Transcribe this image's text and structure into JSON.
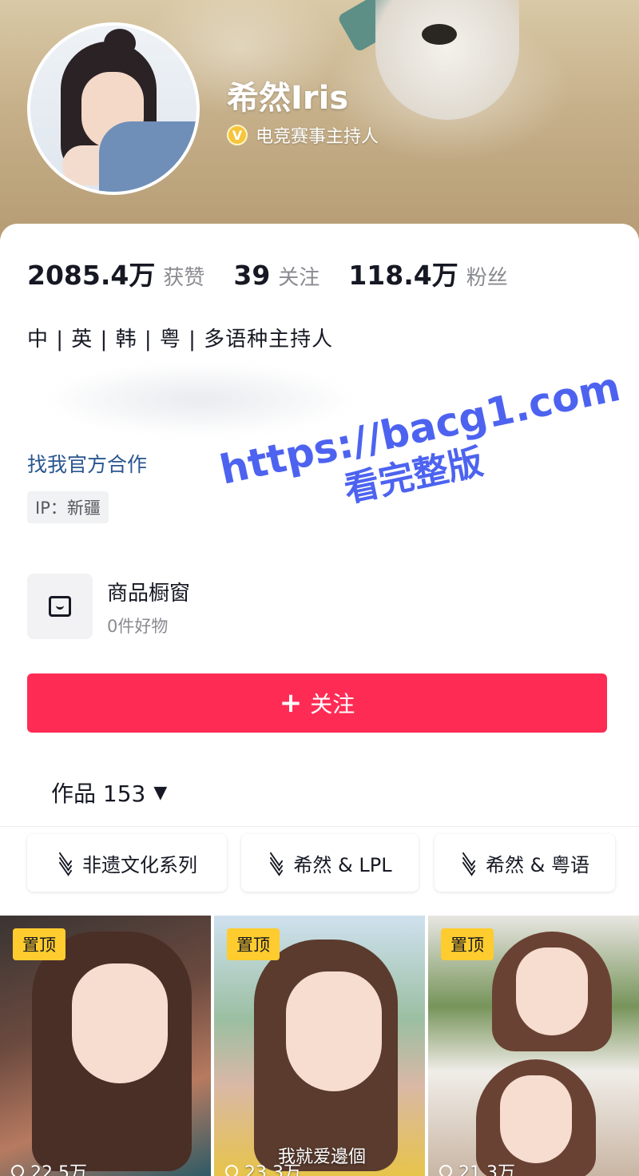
{
  "profile": {
    "name": "希然Iris",
    "verification": "电竞赛事主持人",
    "verify_badge": "V"
  },
  "stats": [
    {
      "value": "2085.4万",
      "label": "获赞"
    },
    {
      "value": "39",
      "label": "关注"
    },
    {
      "value": "118.4万",
      "label": "粉丝"
    }
  ],
  "bio": {
    "line1": "中 | 英 | 韩 | 粤 | 多语种主持人",
    "coop_link": "找我官方合作",
    "ip_location": "IP：新疆"
  },
  "shop": {
    "title": "商品橱窗",
    "subtitle": "0件好物",
    "icon": "shopping-bag-icon"
  },
  "follow_button": {
    "plus": "+",
    "label": "关注",
    "color": "#fe2c55"
  },
  "works": {
    "label": "作品 153",
    "caret": "▼"
  },
  "collections": [
    {
      "label": "非遗文化系列",
      "icon": "stack-icon"
    },
    {
      "label": "希然 & LPL",
      "icon": "stack-icon"
    },
    {
      "label": "希然 & 粤语",
      "icon": "stack-icon"
    }
  ],
  "videos": [
    {
      "pinned": "置顶",
      "views": "22.5万"
    },
    {
      "pinned": "置顶",
      "views": "23.3万",
      "caption": "我就爱邊個"
    },
    {
      "pinned": "置顶",
      "views": "21.3万"
    }
  ],
  "watermark": {
    "url": "https://bacg1.com",
    "text": "看完整版",
    "color": "#4d63f0"
  }
}
